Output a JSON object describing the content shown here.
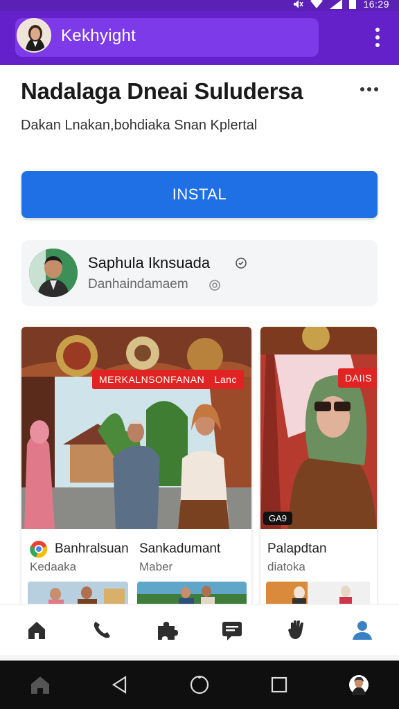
{
  "status_bar": {
    "time": "16:29"
  },
  "app_bar": {
    "title": "Kekhyight",
    "avatar": "profile-photo",
    "menu_icon": "more-vert-icon"
  },
  "header": {
    "title": "Nadalaga Dneai Suludersa",
    "subtitle": "Dakan Lnakan,bohdiaka Snan Kplertal"
  },
  "install": {
    "label": "INSTAL",
    "color": "#1f6fe5"
  },
  "developer": {
    "name": "Saphula Iknsuada",
    "subtitle": "Danhaindamaem"
  },
  "cards": [
    {
      "banner": "MERKALNSONFANAN",
      "banner_tail": "Lanc",
      "title": "Banhralsuan",
      "subtitle": "Kedaaka",
      "title2": "Sankadumant",
      "subtitle2": "Maber"
    },
    {
      "banner": "DAIIS",
      "badge": "GA9",
      "title": "Palapdtan",
      "subtitle": "diatoka"
    }
  ],
  "bottom_nav": {
    "items": [
      "home-icon",
      "phone-icon",
      "puzzle-icon",
      "message-icon",
      "hand-icon",
      "profile-icon"
    ],
    "active": "profile-icon",
    "active_color": "#3b82c4"
  },
  "system_nav": [
    "home",
    "back",
    "circle",
    "recents",
    "avatar"
  ],
  "colors": {
    "app_bar": "#6420c9",
    "status_bar": "#5b21b6",
    "install_button": "#1f6fe5",
    "badge_red": "#e02424"
  }
}
